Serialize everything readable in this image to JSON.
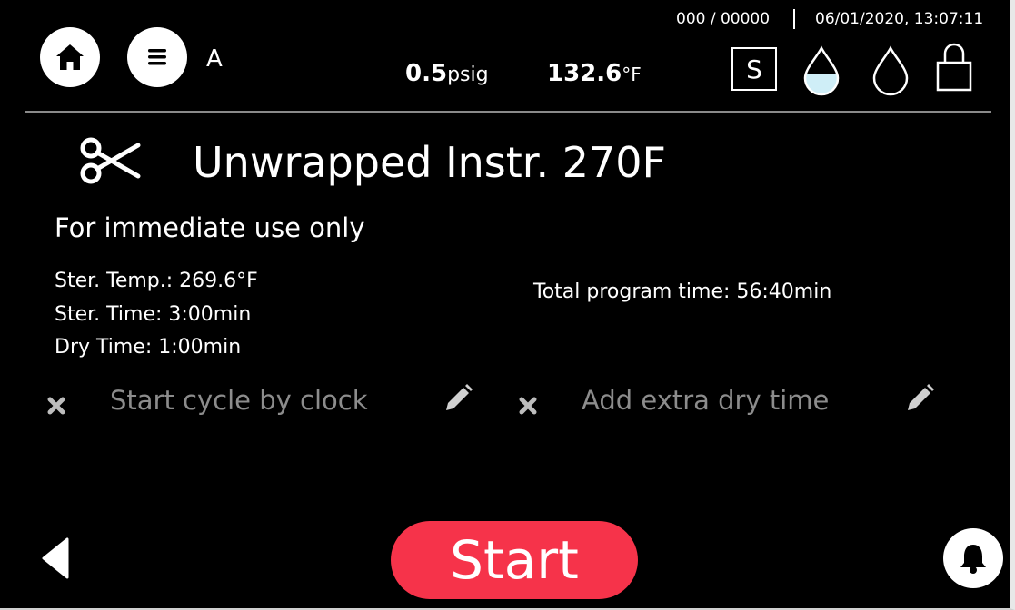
{
  "header": {
    "home_icon": "home-icon",
    "menu_icon": "menu-icon",
    "user": "A",
    "counter": "000 / 00000",
    "datetime": "06/01/2020, 13:07:11",
    "pressure_value": "0.5",
    "pressure_unit": "psig",
    "temperature_value": "132.6",
    "temperature_unit": "°F",
    "status_s": "S",
    "status_icons": [
      "water-tank-partial-icon",
      "water-drop-empty-icon",
      "lock-icon"
    ]
  },
  "program": {
    "icon": "scissors-icon",
    "title": "Unwrapped Instr. 270F",
    "subtitle": "For immediate use only",
    "ster_temp": "Ster. Temp.: 269.6°F",
    "ster_time": "Ster. Time: 3:00min",
    "dry_time": "Dry Time: 1:00min",
    "total_time": "Total program time: 56:40min"
  },
  "options": [
    {
      "label": "Start cycle by clock",
      "icon": "x-icon",
      "edit_icon": "pencil-icon"
    },
    {
      "label": "Add extra dry time",
      "icon": "x-icon",
      "edit_icon": "pencil-icon"
    }
  ],
  "footer": {
    "back_icon": "back-arrow-icon",
    "start_label": "Start",
    "bell_icon": "bell-icon"
  },
  "colors": {
    "background": "#000000",
    "start_button": "#f6334a",
    "disabled_text": "#8c8c8c",
    "water_level": "#cfeef7",
    "divider": "#8a8a8a"
  }
}
